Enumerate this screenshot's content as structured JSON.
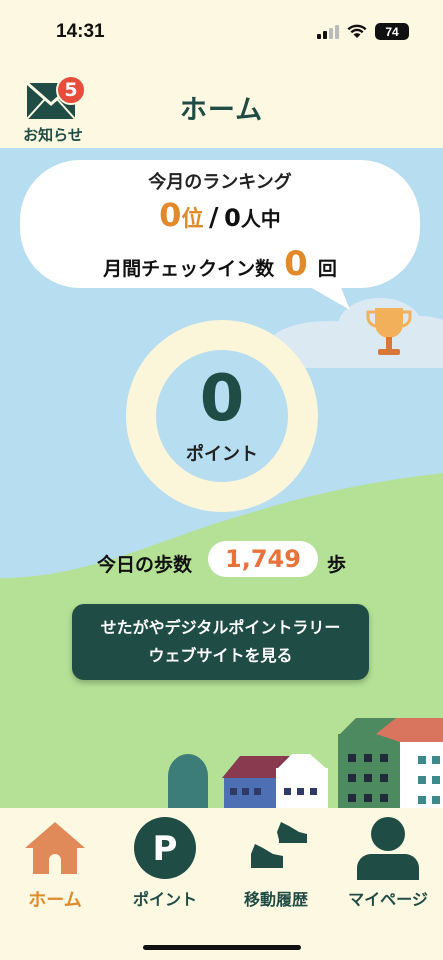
{
  "status": {
    "time": "14:31",
    "battery": "74"
  },
  "header": {
    "title": "ホーム",
    "notice_label": "お知らせ",
    "notice_count": "5"
  },
  "ranking": {
    "title": "今月のランキング",
    "rank_value": "0",
    "rank_unit": "位",
    "separator": "/",
    "total_value": "0",
    "total_unit": "人中",
    "checkin_label": "月間チェックイン数",
    "checkin_value": "0",
    "checkin_unit": "回"
  },
  "points": {
    "value": "0",
    "label": "ポイント"
  },
  "steps": {
    "label": "今日の歩数",
    "value": "1,749",
    "unit": "歩"
  },
  "web_button": {
    "line1": "せたがやデジタルポイントラリー",
    "line2": "ウェブサイトを見る"
  },
  "tabs": [
    {
      "label": "ホーム",
      "icon": "home-icon",
      "active": true
    },
    {
      "label": "ポイント",
      "icon": "points-icon",
      "active": false
    },
    {
      "label": "移動履歴",
      "icon": "shoes-icon",
      "active": false
    },
    {
      "label": "マイページ",
      "icon": "person-icon",
      "active": false
    }
  ],
  "colors": {
    "accent": "#e08a2c",
    "primary": "#1f4d46",
    "sky": "#b7ddf1",
    "grass": "#b4e196",
    "cream": "#fdf8e1",
    "badge": "#e74c3c"
  }
}
